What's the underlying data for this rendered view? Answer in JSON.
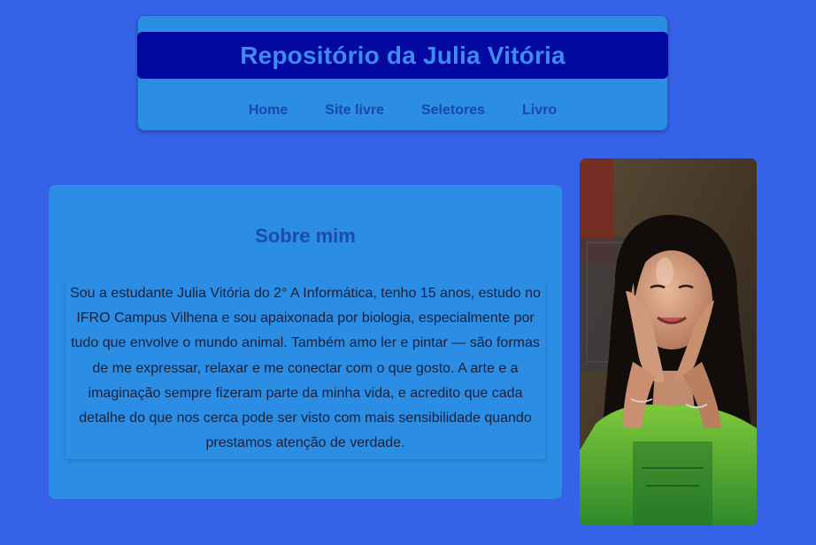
{
  "header": {
    "title": "Repositório da Julia Vitória",
    "nav": [
      {
        "label": "Home"
      },
      {
        "label": "Site livre"
      },
      {
        "label": "Seletores"
      },
      {
        "label": "Livro"
      }
    ]
  },
  "about": {
    "heading": "Sobre mim",
    "text": "Sou a estudante Julia Vitória do 2° A Informática, tenho 15 anos, estudo no IFRO Campus Vilhena e sou apaixonada por biologia, especialmente por tudo que envolve o mundo animal. Também amo ler e pintar — são formas de me expressar, relaxar e me conectar com o que gosto. A arte e a imaginação sempre fizeram parte da minha vida, e acredito que cada detalhe do que nos cerca pode ser visto com mais sensibilidade quando prestamos atenção de verdade."
  },
  "colors": {
    "page_background": "#3662E8",
    "card_background": "#2B8EE4",
    "title_bar": "#0208A0",
    "title_text": "#3E8CF0",
    "nav_text": "#1848A8"
  }
}
